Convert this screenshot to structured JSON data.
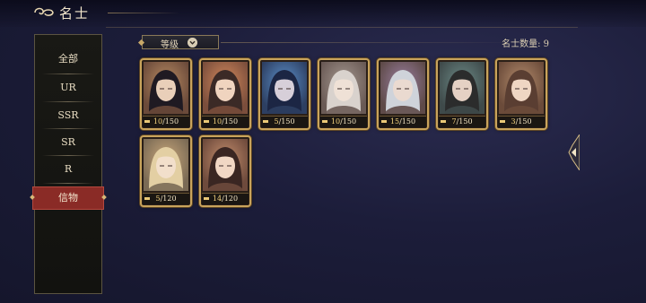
{
  "header": {
    "title": "名士"
  },
  "sidebar": {
    "items": [
      {
        "label": "全部",
        "active": false
      },
      {
        "label": "UR",
        "active": false
      },
      {
        "label": "SSR",
        "active": false
      },
      {
        "label": "SR",
        "active": false
      },
      {
        "label": "R",
        "active": false
      },
      {
        "label": "信物",
        "active": true
      }
    ]
  },
  "toolbar": {
    "sort_label": "等级",
    "count_text": "名士数量: 9"
  },
  "cards": [
    {
      "level": "10",
      "max": "150",
      "progress": 0.07,
      "palette": "dark"
    },
    {
      "level": "10",
      "max": "150",
      "progress": 0.07,
      "palette": "warm"
    },
    {
      "level": "5",
      "max": "150",
      "progress": 0.03,
      "palette": "blue"
    },
    {
      "level": "10",
      "max": "150",
      "progress": 0.07,
      "palette": "pale"
    },
    {
      "level": "15",
      "max": "150",
      "progress": 0.1,
      "palette": "silver"
    },
    {
      "level": "7",
      "max": "150",
      "progress": 0.05,
      "palette": "teal"
    },
    {
      "level": "3",
      "max": "150",
      "progress": 0.02,
      "palette": "brown"
    },
    {
      "level": "5",
      "max": "120",
      "progress": 0.04,
      "palette": "blonde"
    },
    {
      "level": "14",
      "max": "120",
      "progress": 0.12,
      "palette": "dark-girl"
    }
  ],
  "icons": {
    "back": "back-swirl-icon",
    "sort": "chevron-down-icon",
    "edge": "arrow-left-icon"
  },
  "colors": {
    "accent_gold": "#c9a45c",
    "active_red": "#8a2b26"
  }
}
